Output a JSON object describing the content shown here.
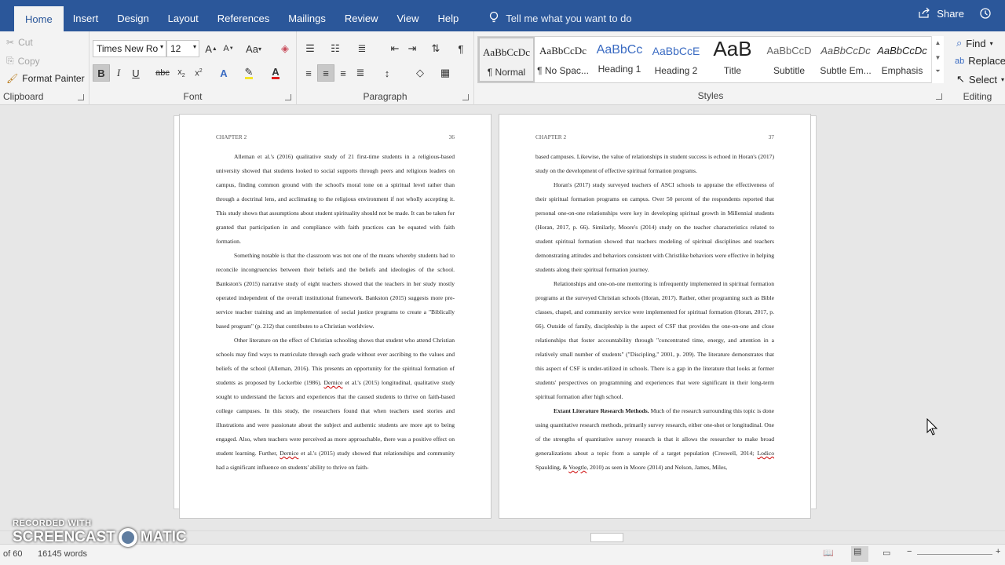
{
  "tabs": [
    "Home",
    "Insert",
    "Design",
    "Layout",
    "References",
    "Mailings",
    "Review",
    "View",
    "Help"
  ],
  "tell_me": "Tell me what you want to do",
  "share": "Share",
  "clipboard": {
    "cut": "Cut",
    "copy": "Copy",
    "format_painter": "Format Painter",
    "label": "Clipboard"
  },
  "font": {
    "name": "Times New Ro",
    "size": "12",
    "label": "Font",
    "grow": "A",
    "shrink": "A",
    "case": "Aa",
    "bold": "B",
    "italic": "I",
    "underline": "U",
    "strike": "abc",
    "sub": "x2",
    "sup": "x2"
  },
  "paragraph": {
    "label": "Paragraph",
    "pilcrow": "¶"
  },
  "styles": {
    "label": "Styles",
    "items": [
      {
        "preview": "AaBbCcDc",
        "name": "¶ Normal"
      },
      {
        "preview": "AaBbCcDc",
        "name": "¶ No Spac..."
      },
      {
        "preview": "AaBbCc",
        "name": "Heading 1"
      },
      {
        "preview": "AaBbCcE",
        "name": "Heading 2"
      },
      {
        "preview": "AaB",
        "name": "Title"
      },
      {
        "preview": "AaBbCcD",
        "name": "Subtitle"
      },
      {
        "preview": "AaBbCcDc",
        "name": "Subtle Em..."
      },
      {
        "preview": "AaBbCcDc",
        "name": "Emphasis"
      }
    ]
  },
  "editing": {
    "find": "Find",
    "replace": "Replace",
    "select": "Select",
    "label": "Editing"
  },
  "page1": {
    "header": "CHAPTER 2",
    "number": "36",
    "p1": "Alleman et al.'s (2016) qualitative study of 21 first-time students in a religious-based university showed that students looked to social supports through peers and religious leaders on campus, finding common ground with the school's moral tone on a spiritual level rather than through a doctrinal lens, and acclimating to the religious environment if not wholly accepting it. This study shows that assumptions about student spirituality should not be made. It can be taken for granted that participation in and compliance with faith practices can be equated with faith formation.",
    "p2": "Something notable is that the classroom was not one of the means whereby students had to reconcile incongruencies between their beliefs and the beliefs and ideologies of the school. Bankston's (2015) narrative study of eight teachers showed that the teachers in her study mostly operated independent of the overall institutional framework. Bankston (2015) suggests more pre-service teacher training and an implementation of social justice programs to create a \"Biblically based program\" (p. 212) that contributes to a Christian worldview.",
    "p3a": "Other literature on the effect of Christian schooling shows that student who attend Christian schools may find ways to matriculate through each grade without ever ascribing to the values and beliefs of the school (Alleman, 2016). This presents an opportunity for the spiritual formation of students as proposed by Lockerbie (1986). ",
    "p3b": "Dernice",
    "p3c": " et al.'s (2015) longitudinal, qualitative study sought to understand the factors and experiences that the caused students to thrive on faith-based college campuses. In this study, the researchers found that when teachers used stories and illustrations and were passionate about the subject and authentic students are more apt to being engaged. Also, when teachers were perceived as more approachable, there was a positive effect on student learning. Further, ",
    "p3d": "Dernice",
    "p3e": " et al.'s (2015) study showed that relationships and community had a significant influence on students' ability to thrive on faith-"
  },
  "page2": {
    "header": "CHAPTER 2",
    "number": "37",
    "p0": "based campuses. Likewise, the value of relationships in student success is echoed in Horan's (2017) study on the development of effective spiritual formation programs.",
    "p1": "Horan's (2017) study surveyed teachers of ASCI schools to appraise the effectiveness of their spiritual formation programs on campus. Over 50 percent of the respondents reported that personal one-on-one relationships were key in developing spiritual growth in Millennial students (Horan, 2017, p. 66). Similarly, Moore's (2014) study on the teacher characteristics related to student spiritual formation showed that teachers modeling of spiritual disciplines and teachers demonstrating attitudes and behaviors consistent with Christlike behaviors were effective in helping students along their spiritual formation journey.",
    "p2": "Relationships and one-on-one mentoring is infrequently implemented in spiritual formation programs at the surveyed Christian schools (Horan, 2017). Rather, other programing such as Bible classes, chapel, and community service were implemented for spiritual formation (Horan, 2017, p. 66). Outside of family, discipleship is the aspect of CSF that provides the one-on-one and close relationships that foster accountability through \"concentrated time, energy, and attention in a relatively small number of students\" (\"Discipling,\" 2001, p. 209). The literature demonstrates that this aspect of CSF is under-utilized in schools. There is a gap in the literature that looks at former students' perspectives on programming and experiences that were significant in their long-term spiritual formation after high school.",
    "p3head": "Extant Literature Research Methods.",
    "p3a": " Much of the research surrounding this topic is done using quantitative research methods, primarily survey research, either one-shot or longitudinal. One of the strengths of quantitative survey research is that it allows the researcher to make broad generalizations about a topic from a sample of a target population (Creswell, 2014; ",
    "p3b": "Lodico",
    "p3c": " Spaulding, & ",
    "p3d": "Voegtle",
    "p3e": ", 2010) as seen in Moore (2014) and Nelson, James, Miles,"
  },
  "status": {
    "page": "of 60",
    "words": "16145 words"
  },
  "watermark": {
    "top": "RECORDED WITH",
    "left": "SCREENCAST",
    "right": "MATIC"
  }
}
